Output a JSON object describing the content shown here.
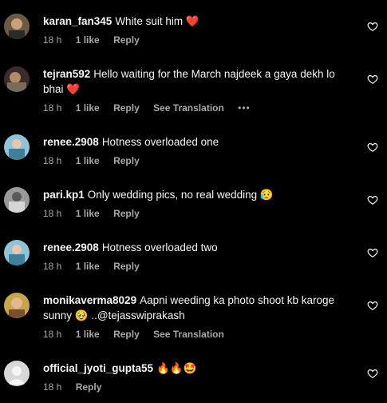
{
  "comments": [
    {
      "username": "karan_fan345",
      "text": "White suit him ❤️",
      "time": "18 h",
      "likes": "1 like",
      "reply": "Reply",
      "see_translation": "",
      "more": ""
    },
    {
      "username": "tejran592",
      "text": "Hello waiting for the March najdeek a gaya dekh lo bhai ❤️",
      "time": "18 h",
      "likes": "1 like",
      "reply": "Reply",
      "see_translation": "See Translation",
      "more": "•••"
    },
    {
      "username": "renee.2908",
      "text": "Hotness overloaded one",
      "time": "18 h",
      "likes": "1 like",
      "reply": "Reply",
      "see_translation": "",
      "more": ""
    },
    {
      "username": "pari.kp1",
      "text": "Only wedding pics, no real wedding 😥",
      "time": "18 h",
      "likes": "1 like",
      "reply": "Reply",
      "see_translation": "",
      "more": ""
    },
    {
      "username": "renee.2908",
      "text": "Hotness overloaded two",
      "time": "18 h",
      "likes": "1 like",
      "reply": "Reply",
      "see_translation": "",
      "more": ""
    },
    {
      "username": "monikaverma8029",
      "text": "Aapni weeding ka photo shoot kb karoge sunny 🥹 ..@tejasswiprakash",
      "time": "18 h",
      "likes": "1 like",
      "reply": "Reply",
      "see_translation": "See Translation",
      "more": ""
    },
    {
      "username": "official_jyoti_gupta55",
      "text": "🔥🔥🤩",
      "time": "18 h",
      "likes": "",
      "reply": "Reply",
      "see_translation": "",
      "more": ""
    }
  ],
  "colors": {
    "background": "#000000",
    "text": "#f5f5f5",
    "meta": "#a8a8a8",
    "heart": "#ff3040"
  },
  "icons": {
    "like": "heart-outline-icon",
    "more": "more-options-icon"
  }
}
